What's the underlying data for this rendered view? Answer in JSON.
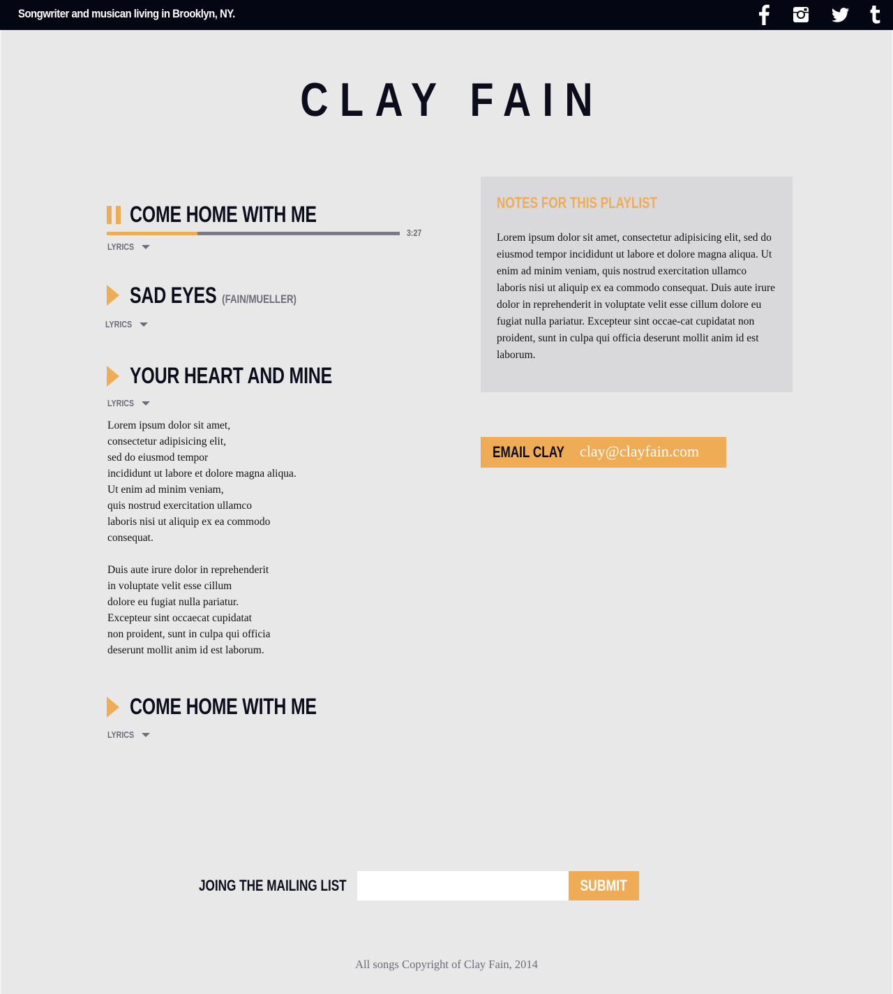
{
  "header": {
    "tagline": "Songwriter and musican living in Brooklyn, NY.",
    "social_icons": [
      "facebook-icon",
      "instagram-icon",
      "twitter-icon",
      "tumblr-icon"
    ]
  },
  "site_title": "CLAY FAIN",
  "playlist": {
    "lyrics_label": "LYRICS",
    "songs": [
      {
        "title": "COME HOME WITH ME",
        "credit": "",
        "state": "playing",
        "progress": 0.31,
        "duration": "3:27"
      },
      {
        "title": "SAD EYES",
        "credit": "(FAIN/MUELLER)",
        "state": "paused"
      },
      {
        "title": "YOUR HEART AND MINE",
        "credit": "",
        "state": "paused",
        "lyrics": [
          "Lorem ipsum dolor sit amet,\nconsectetur adipisicing elit,\nsed do eiusmod tempor\nincididunt ut labore et dolore magna aliqua.\nUt enim ad minim veniam,\nquis nostrud exercitation ullamco\nlaboris nisi ut aliquip ex ea commodo\nconsequat.",
          "Duis aute irure dolor in reprehenderit\nin voluptate velit esse cillum\ndolore eu fugiat nulla pariatur.\nExcepteur sint occaecat cupidatat\nnon proident, sunt in culpa qui officia\ndeserunt mollit anim id est laborum."
        ]
      },
      {
        "title": "COME HOME WITH ME",
        "credit": "",
        "state": "paused"
      }
    ]
  },
  "notes": {
    "heading": "NOTES FOR THIS PLAYLIST",
    "body": "Lorem ipsum dolor sit amet, consectetur adipisicing elit, sed do eiusmod tempor incididunt ut labore et dolore magna aliqua. Ut enim ad minim veniam, quis nostrud exercitation ullamco laboris nisi ut aliquip ex ea commodo consequat. Duis aute irure dolor in reprehenderit in voluptate velit esse cillum dolore eu fugiat nulla pariatur. Excepteur sint occae-cat cupidatat non proident, sunt in culpa qui officia deserunt mollit anim id est laborum."
  },
  "email": {
    "label": "EMAIL CLAY",
    "address": "clay@clayfain.com"
  },
  "mailing_list": {
    "label": "JOING THE MAILING LIST",
    "input_value": "",
    "submit_label": "SUBMIT"
  },
  "footer": {
    "copyright": "All songs Copyright of Clay Fain, 2014"
  },
  "colors": {
    "accent": "#f0ac55",
    "topbar": "#050614",
    "background": "#e8e8e8",
    "notes_bg": "#d9d9dc",
    "text_dark": "#0b0c1c",
    "text_muted": "#6c6c7a"
  }
}
